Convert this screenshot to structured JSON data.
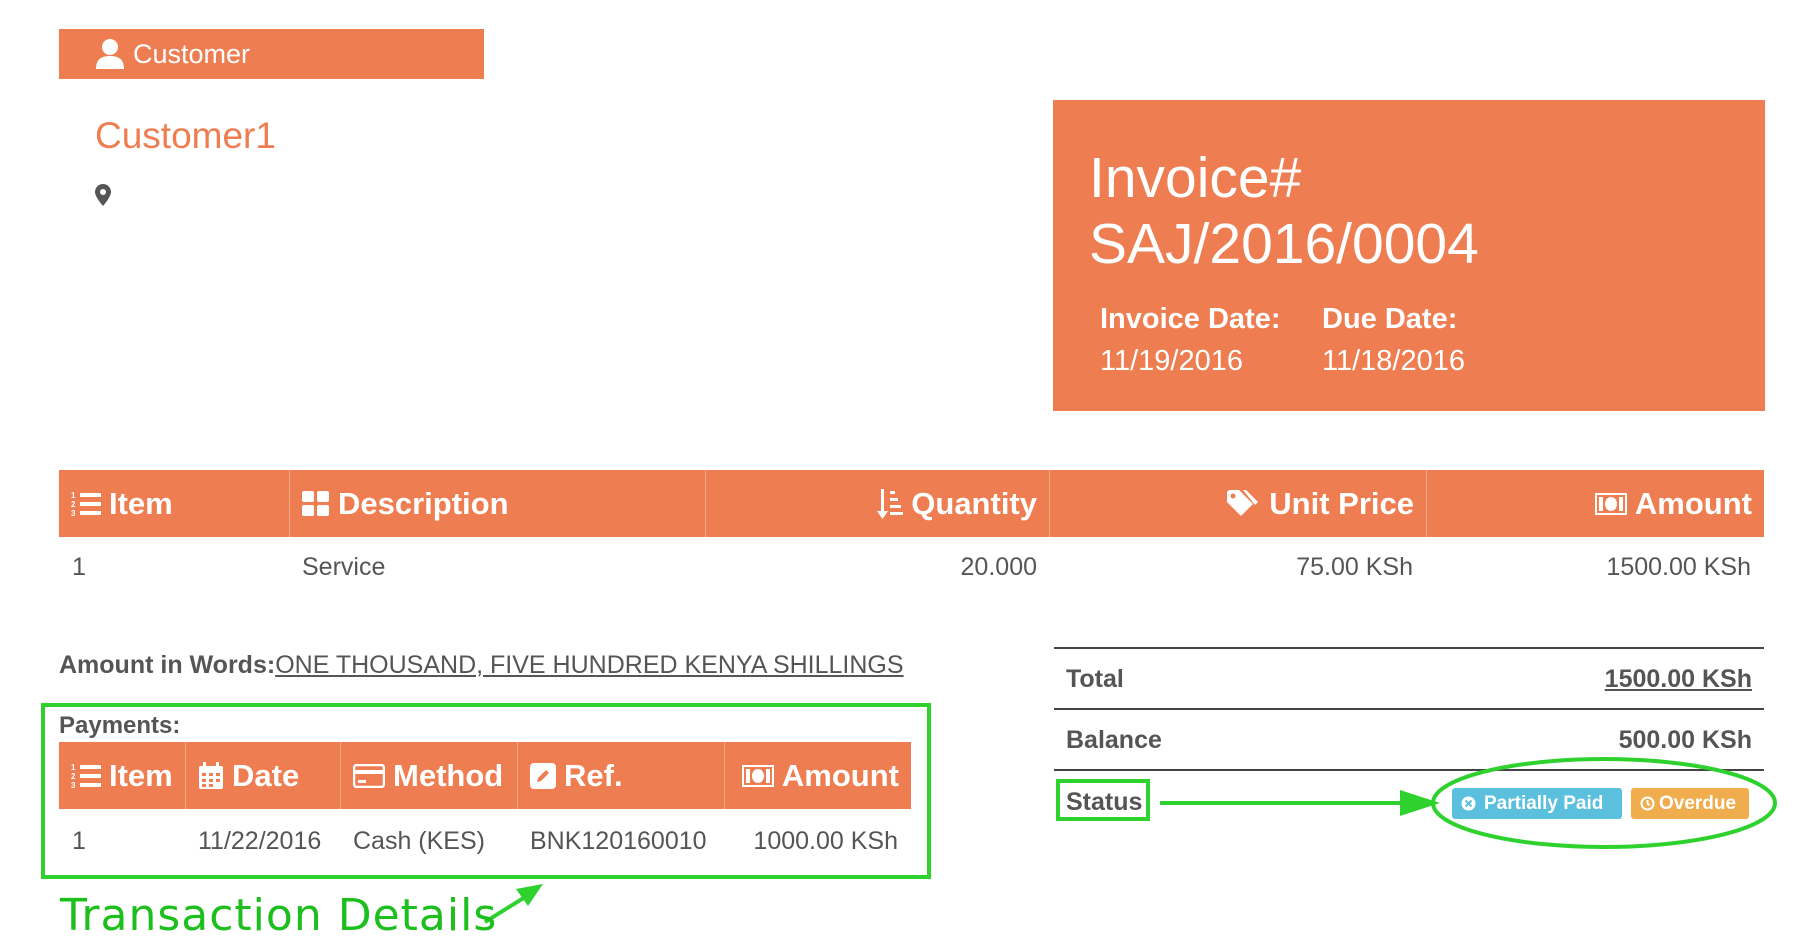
{
  "customer": {
    "section_label": "Customer",
    "name": "Customer1",
    "icons": [
      "user-icon",
      "map-pin-icon"
    ]
  },
  "invoice": {
    "title_line1": "Invoice#",
    "title_line2": "SAJ/2016/0004",
    "date_label": "Invoice Date:",
    "date_value": "11/19/2016",
    "due_label": "Due Date:",
    "due_value": "11/18/2016"
  },
  "items": {
    "headers": {
      "item": "Item",
      "description": "Description",
      "quantity": "Quantity",
      "unit_price": "Unit Price",
      "amount": "Amount"
    },
    "rows": [
      {
        "item": "1",
        "description": "Service",
        "quantity": "20.000",
        "unit_price": "75.00 KSh",
        "amount": "1500.00 KSh"
      }
    ]
  },
  "amount_in_words": {
    "label": "Amount in Words:",
    "value": "ONE THOUSAND, FIVE HUNDRED KENYA SHILLINGS"
  },
  "totals": {
    "total_label": "Total",
    "total_value": "1500.00 KSh",
    "balance_label": "Balance",
    "balance_value": "500.00 KSh",
    "status_label": "Status"
  },
  "status_badges": [
    {
      "label": "Partially Paid",
      "color": "#5bc0de",
      "icon": "circle-x-icon"
    },
    {
      "label": "Overdue",
      "color": "#f0ad4e",
      "icon": "clock-icon"
    }
  ],
  "payments": {
    "label": "Payments:",
    "headers": {
      "item": "Item",
      "date": "Date",
      "method": "Method",
      "ref": "Ref.",
      "amount": "Amount"
    },
    "rows": [
      {
        "item": "1",
        "date": "11/22/2016",
        "method": "Cash (KES)",
        "ref": "BNK120160010",
        "amount": "1000.00 KSh"
      }
    ]
  },
  "annotation": {
    "text": "Transaction Details"
  },
  "colors": {
    "accent": "#ee7e51",
    "annotation": "#2ed12e"
  }
}
